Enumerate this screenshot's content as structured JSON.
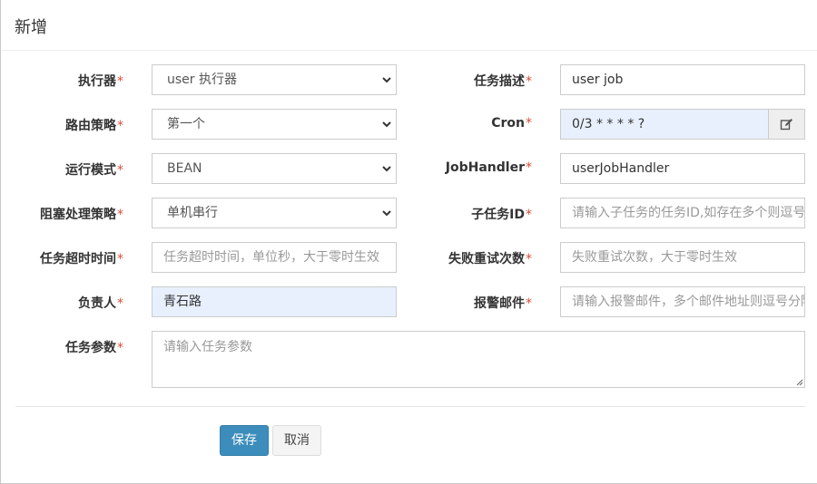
{
  "modal": {
    "title": "新增"
  },
  "form": {
    "executor": {
      "label": "执行器",
      "required": "*",
      "value": "user 执行器"
    },
    "route_strategy": {
      "label": "路由策略",
      "required": "*",
      "value": "第一个"
    },
    "run_mode": {
      "label": "运行模式",
      "required": "*",
      "value": "BEAN"
    },
    "block_strategy": {
      "label": "阻塞处理策略",
      "required": "*",
      "value": "单机串行"
    },
    "timeout": {
      "label": "任务超时时间",
      "required": "*",
      "placeholder": "任务超时时间，单位秒，大于零时生效"
    },
    "author": {
      "label": "负责人",
      "required": "*",
      "value": "青石路"
    },
    "job_param": {
      "label": "任务参数",
      "required": "*",
      "placeholder": "请输入任务参数"
    },
    "job_desc": {
      "label": "任务描述",
      "required": "*",
      "value": "user job"
    },
    "cron": {
      "label": "Cron",
      "required": "*",
      "value": "0/3 * * * * ?"
    },
    "job_handler": {
      "label": "JobHandler",
      "required": "*",
      "value": "userJobHandler"
    },
    "child_job_id": {
      "label": "子任务ID",
      "required": "*",
      "placeholder": "请输入子任务的任务ID,如存在多个则逗号分隔"
    },
    "fail_retry": {
      "label": "失败重试次数",
      "required": "*",
      "placeholder": "失败重试次数，大于零时生效"
    },
    "alarm_email": {
      "label": "报警邮件",
      "required": "*",
      "placeholder": "请输入报警邮件，多个邮件地址则逗号分隔"
    }
  },
  "actions": {
    "save": "保存",
    "cancel": "取消"
  },
  "icons": {
    "select_arrow": "chevron-down-icon",
    "cron_edit": "edit-icon"
  },
  "colors": {
    "primary": "#3c8dbc",
    "required": "#dd4b39",
    "autofill": "#e8f0fe"
  }
}
